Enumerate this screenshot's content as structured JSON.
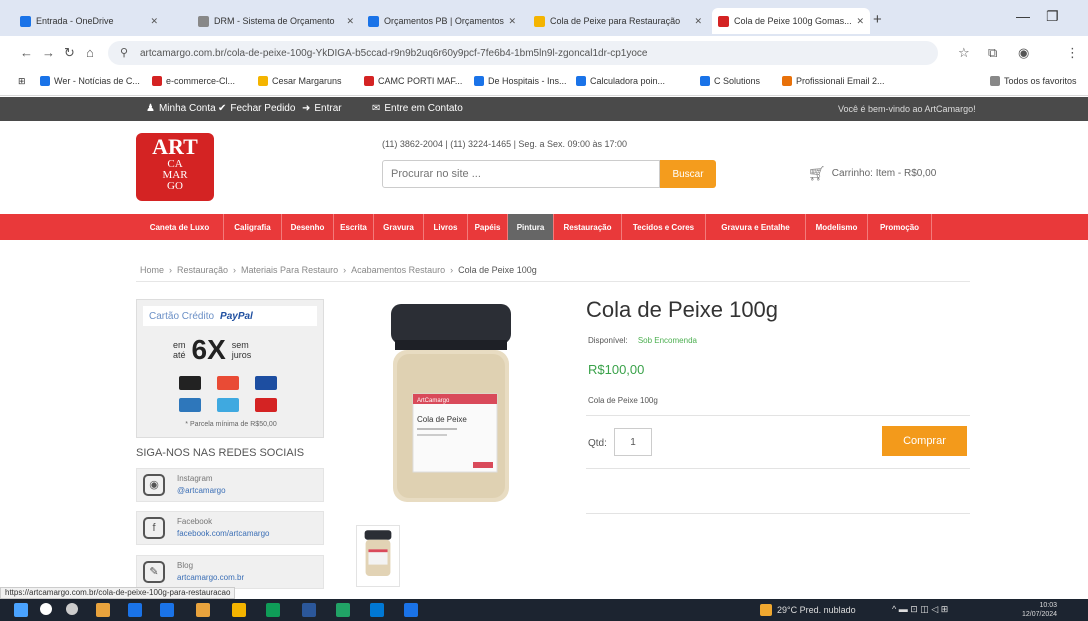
{
  "browser": {
    "tabs": [
      {
        "label": "Entrada - OneDrive",
        "color": "#1a73e8"
      },
      {
        "label": "DRM - Sistema de Orçamento",
        "color": "#888888"
      },
      {
        "label": "Orçamentos PB | Orçamentos",
        "color": "#1a73e8"
      },
      {
        "label": "Cola de Peixe para Restauração",
        "color": "#f4b400"
      },
      {
        "label": "Cola de Peixe 100g Gomas...",
        "color": "#d42323"
      }
    ],
    "new_tab": "+",
    "minimize": "—",
    "maximize": "❐",
    "back": "←",
    "forward": "→",
    "reload": "↻",
    "home": "⌂",
    "url": "artcamargo.com.br/cola-de-peixe-100g-YkDIGA-b5ccad-r9n9b2uq6r60y9pcf-7fe6b4-1bm5ln9l-zgoncal1dr-cp1yoce",
    "bookmarks": [
      {
        "label": "Wer - Notícias de C...",
        "color": "#1a73e8"
      },
      {
        "label": "e-commerce-Cl...",
        "color": "#d42323"
      },
      {
        "label": "Cesar Margaruns",
        "color": "#f4b400"
      },
      {
        "label": "CAMC PORTI MAF...",
        "color": "#d42323"
      },
      {
        "label": "De Hospitais - Ins...",
        "color": "#1a73e8"
      },
      {
        "label": "Calculadora poin...",
        "color": "#1a73e8"
      },
      {
        "label": "C Solutions",
        "color": "#1a73e8"
      },
      {
        "label": "Profissionali Email 2...",
        "color": "#e8710a"
      },
      {
        "label": "Todos os favoritos",
        "color": "#888888"
      }
    ]
  },
  "site": {
    "toplinks": [
      {
        "label": "Minha Conta",
        "icon": "user-icon"
      },
      {
        "label": "Fechar Pedido",
        "icon": "check-icon"
      },
      {
        "label": "Entrar",
        "icon": "login-icon"
      },
      {
        "label": "Entre em Contato",
        "icon": "mail-icon"
      }
    ],
    "welcome": "Você é bem-vindo ao ArtCamargo!",
    "logo": {
      "line1": "ART",
      "line2": "CA",
      "line3": "MAR",
      "line4": "GO"
    },
    "contact": "(11) 3862-2004 | (11) 3224-1465 | Seg. a Sex. 09:00 às 17:00",
    "search": {
      "placeholder": "Procurar no site ...",
      "button": "Buscar"
    },
    "cart": {
      "label": "Carrinho: Item - R$0,00"
    },
    "categories": [
      {
        "label": "Caneta de Luxo",
        "active": false
      },
      {
        "label": "Caligrafia",
        "active": false
      },
      {
        "label": "Desenho",
        "active": false
      },
      {
        "label": "Escrita",
        "active": false
      },
      {
        "label": "Gravura",
        "active": false
      },
      {
        "label": "Livros",
        "active": false
      },
      {
        "label": "Papéis",
        "active": false
      },
      {
        "label": "Pintura",
        "active": true
      },
      {
        "label": "Restauração",
        "active": false
      },
      {
        "label": "Tecidos e Cores",
        "active": false
      },
      {
        "label": "Gravura e Entalhe",
        "active": false
      },
      {
        "label": "Modelismo",
        "active": false
      },
      {
        "label": "Promoção",
        "active": false
      }
    ],
    "breadcrumb": [
      "Home",
      "›",
      "Restauração",
      "›",
      "Materiais Para Restauro",
      "›",
      "Acabamentos Restauro",
      "›",
      "Cola de Peixe 100g"
    ]
  },
  "sidebar": {
    "payment": {
      "header": "Cartão Crédito",
      "paypal": "PayPal",
      "prefix_top": "em",
      "prefix_bottom": "até",
      "count": "6X",
      "suffix_top": "sem",
      "suffix_bottom": "juros",
      "card_colors": [
        "#222222",
        "#e94b35",
        "#1d4ea1",
        "#2e77bb",
        "#3fa9e0",
        "#d42323"
      ],
      "note": "* Parcela mínima de R$50,00"
    },
    "social_title": "SIGA-NOS NAS REDES SOCIAIS",
    "social": [
      {
        "name": "Instagram",
        "link": "@artcamargo",
        "icon": "instagram-icon",
        "glyph": "◉"
      },
      {
        "name": "Facebook",
        "link": "facebook.com/artcamargo",
        "icon": "facebook-icon",
        "glyph": "f"
      },
      {
        "name": "Blog",
        "link": "artcamargo.com.br",
        "icon": "blog-icon",
        "glyph": "✎"
      }
    ]
  },
  "product": {
    "title": "Cola de Peixe 100g",
    "availability_label": "Disponível:",
    "availability_value": "Sob Encomenda",
    "price": "R$100,00",
    "short_desc": "Cola de Peixe 100g",
    "qty_label": "Qtd:",
    "qty_value": "1",
    "buy_button": "Comprar",
    "image_label": "Cola de Peixe",
    "image_brand": "ArtCamargo"
  },
  "status_url": "https://artcamargo.com.br/cola-de-peixe-100g-para-restauracao",
  "taskbar": {
    "weather": "29°C Pred. nublado",
    "tray": "^ ▬ ⊡ ◫ ◁ ⊞",
    "time": "10:03",
    "date": "12/07/2024",
    "icon_colors": [
      "#ffffff",
      "#cccccc",
      "#e8a33d",
      "#1a73e8",
      "#1a73e8",
      "#e8a33d",
      "#f4b400",
      "#0f9d58",
      "#2b579a",
      "#21a366",
      "#0078d4",
      "#1a73e8"
    ]
  }
}
